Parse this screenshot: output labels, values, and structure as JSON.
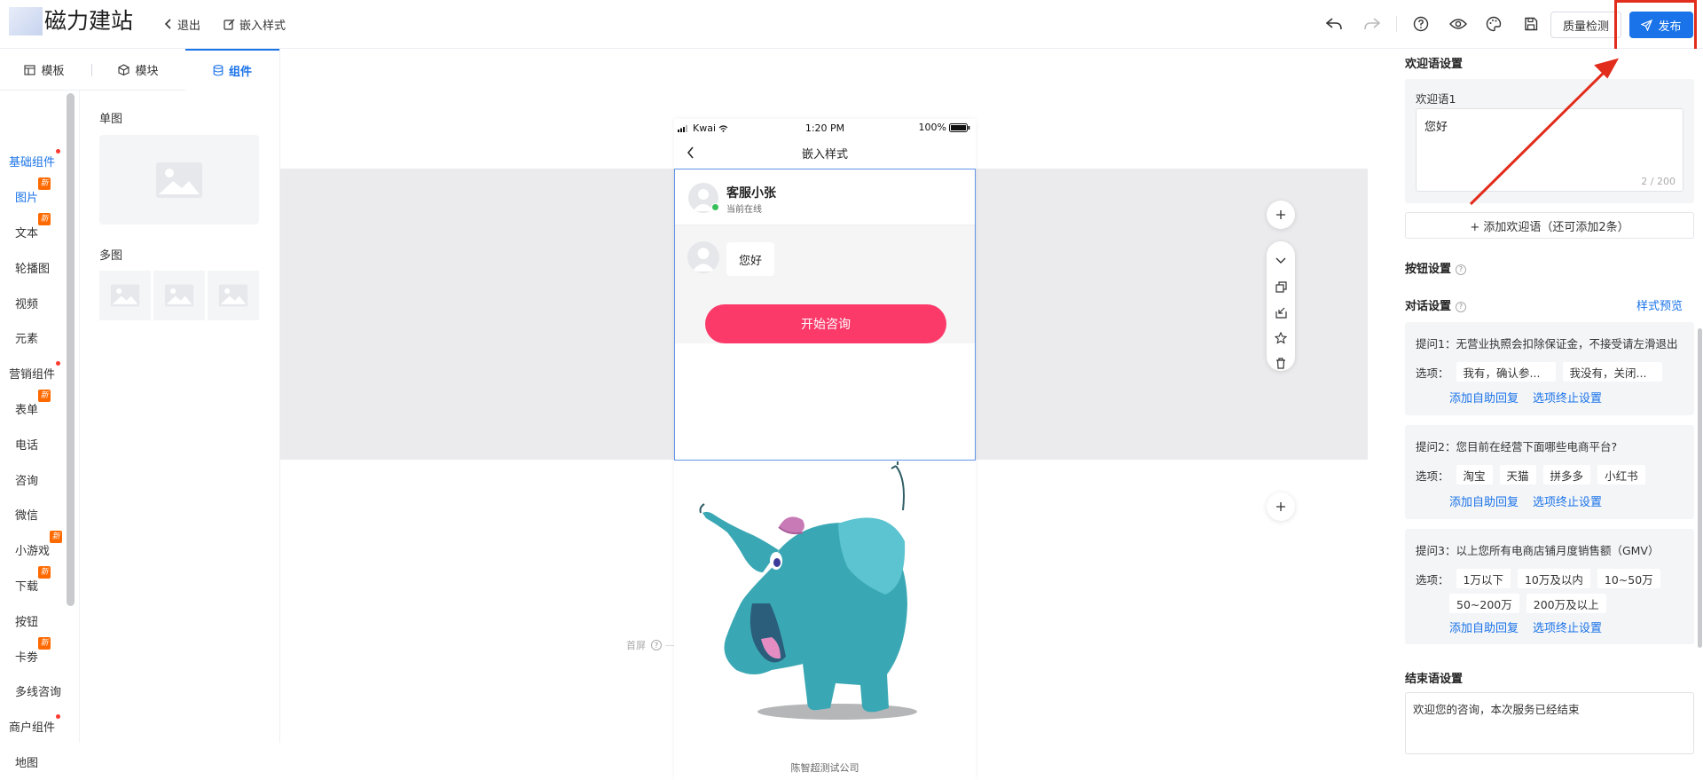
{
  "topbar": {
    "logo_text": "磁力建站",
    "exit_label": "退出",
    "page_label": "嵌入样式",
    "quality_label": "质量检测",
    "publish_label": "发布"
  },
  "left_panel": {
    "tabs": [
      {
        "label": "模板",
        "icon": "template-icon"
      },
      {
        "label": "模块",
        "icon": "cube-icon"
      },
      {
        "label": "组件",
        "icon": "database-icon",
        "active": true
      }
    ],
    "categories": [
      {
        "label": "基础组件",
        "type": "group"
      },
      {
        "label": "图片",
        "new": true,
        "selected": true
      },
      {
        "label": "文本",
        "new": true
      },
      {
        "label": "轮播图"
      },
      {
        "label": "视频"
      },
      {
        "label": "元素"
      },
      {
        "label": "营销组件",
        "type": "group"
      },
      {
        "label": "表单",
        "new": true
      },
      {
        "label": "电话"
      },
      {
        "label": "咨询"
      },
      {
        "label": "微信"
      },
      {
        "label": "小游戏",
        "new": true
      },
      {
        "label": "下载",
        "new": true
      },
      {
        "label": "按钮"
      },
      {
        "label": "卡劵",
        "new": true
      },
      {
        "label": "多线咨询"
      },
      {
        "label": "商户组件",
        "type": "group"
      },
      {
        "label": "地图"
      }
    ],
    "new_badge": "新",
    "single_image_title": "单图",
    "multi_image_title": "多图"
  },
  "phone": {
    "carrier": "Kwai",
    "time": "1:20 PM",
    "battery": "100%",
    "nav_title": "嵌入样式",
    "agent_name": "客服小张",
    "agent_status": "当前在线",
    "greeting_bubble": "您好",
    "start_button": "开始咨询",
    "footer": "陈智超测试公司"
  },
  "canvas": {
    "first_screen_label": "首屏"
  },
  "right_panel": {
    "welcome_title": "欢迎语设置",
    "welcome_label": "欢迎语1",
    "welcome_value": "您好",
    "welcome_counter": "2 / 200",
    "add_welcome": "+ 添加欢迎语（还可添加2条）",
    "button_settings": "按钮设置",
    "dialog_settings": "对话设置",
    "style_preview": "样式预览",
    "options_label": "选项：",
    "add_auto_reply": "添加自助回复",
    "option_end_settings": "选项终止设置",
    "questions": [
      {
        "text": "提问1：无营业执照会扣除保证金，不接受请左滑退出",
        "options": [
          "我有，确认参...",
          "我没有，关闭..."
        ]
      },
      {
        "text": "提问2：您目前在经营下面哪些电商平台?",
        "options": [
          "淘宝",
          "天猫",
          "拼多多",
          "小红书"
        ]
      },
      {
        "text": "提问3：以上您所有电商店铺月度销售额（GMV）",
        "options": [
          "1万以下",
          "10万及以内",
          "10~50万",
          "50~200万",
          "200万及以上"
        ]
      }
    ],
    "closing_title": "结束语设置",
    "closing_value": "欢迎您的咨询，本次服务已经结束"
  },
  "colors": {
    "accent": "#1a73e8",
    "start_button": "#fb3a6a",
    "highlight": "#e22c1c",
    "new_badge": "#ff6a00"
  }
}
